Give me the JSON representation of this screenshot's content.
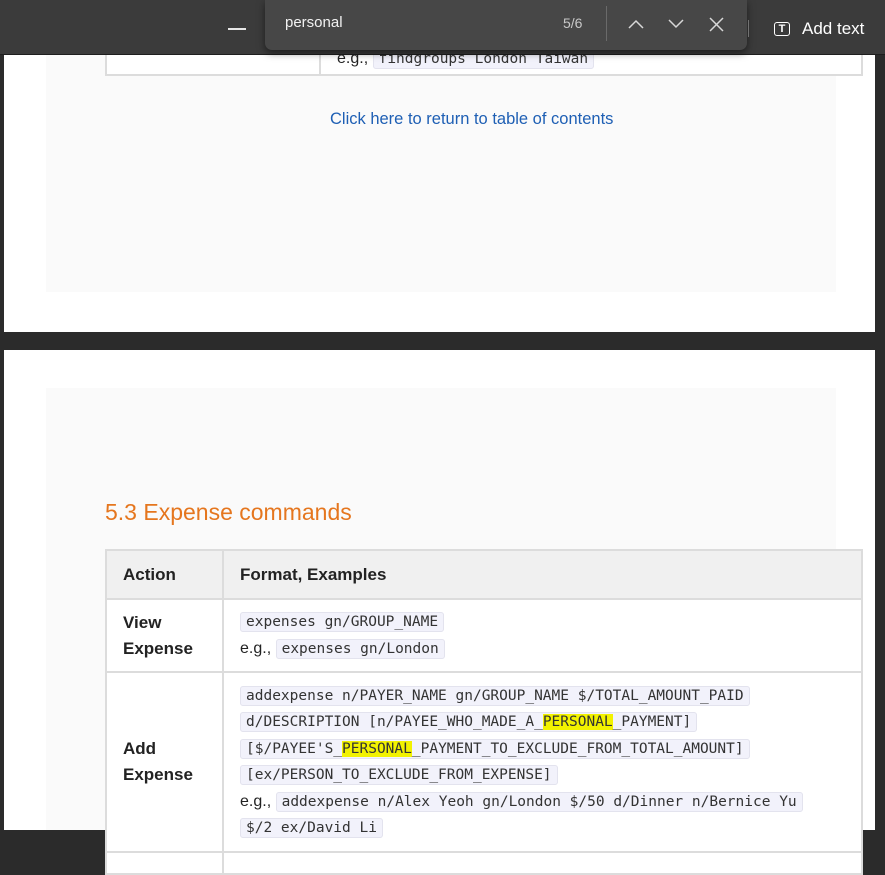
{
  "toolbar": {
    "add_text_label": "Add text",
    "add_text_icon": "text-box-icon",
    "minimize_icon": "minimize-icon"
  },
  "find": {
    "query": "personal",
    "count": "5/6",
    "prev_icon": "chevron-up-icon",
    "next_icon": "chevron-down-icon",
    "close_icon": "close-icon"
  },
  "page1": {
    "partial_example_prefix": "e.g.,",
    "partial_example_code": "findgroups London Taiwan",
    "link_text": "Click here to return to table of contents"
  },
  "section": {
    "title": "5.3 Expense commands",
    "table": {
      "headers": [
        "Action",
        "Format, Examples"
      ],
      "rows": [
        {
          "action_line1": "View",
          "action_line2": "Expense",
          "format_code": "expenses gn/GROUP_NAME",
          "example_prefix": "e.g.,",
          "example_code": "expenses gn/London"
        },
        {
          "action_line1": "Add",
          "action_line2": "Expense",
          "format_line1": "addexpense n/PAYER_NAME gn/GROUP_NAME $/TOTAL_AMOUNT_PAID",
          "format_line2_a": "d/DESCRIPTION [n/PAYEE_WHO_MADE_A_",
          "format_line2_hl": "PERSONAL",
          "format_line2_b": "_PAYMENT]",
          "format_line3_a": "[$/PAYEE'S_",
          "format_line3_hl": "PERSONAL",
          "format_line3_b": "_PAYMENT_TO_EXCLUDE_FROM_TOTAL_AMOUNT]",
          "format_line4": "[ex/PERSON_TO_EXCLUDE_FROM_EXPENSE]",
          "example_prefix": "e.g.,",
          "example_line1": "addexpense n/Alex Yeoh gn/London $/50 d/Dinner n/Bernice Yu",
          "example_line2": "$/2 ex/David Li"
        }
      ]
    }
  },
  "colors": {
    "link": "#1e5fb4",
    "heading": "#e5761e",
    "highlight": "#f2f200",
    "toolbar_bg": "#3b3b3b"
  }
}
